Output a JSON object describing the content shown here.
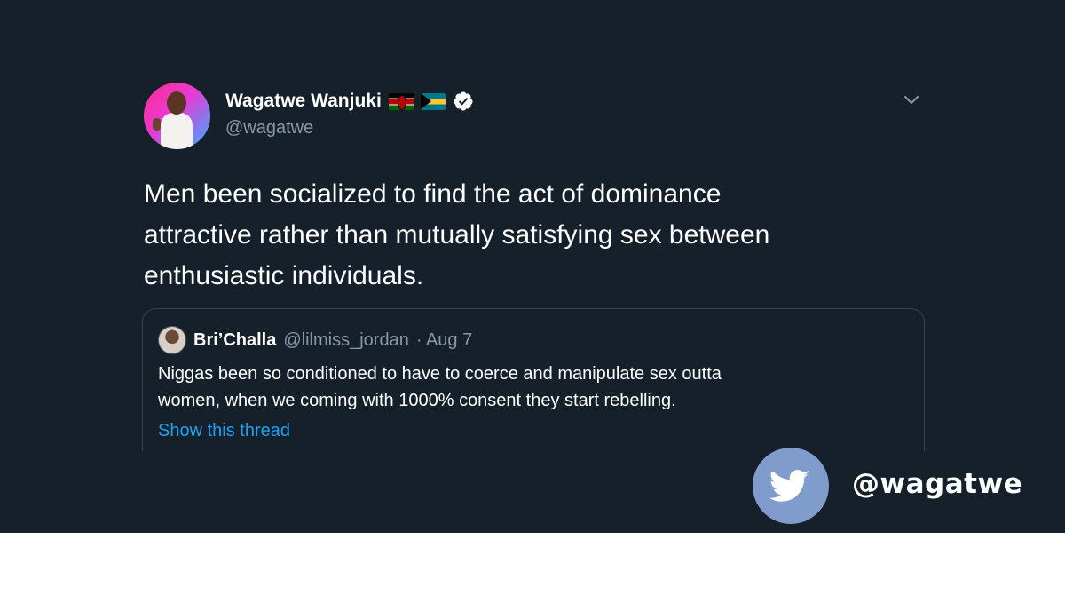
{
  "author": {
    "display_name": "Wagatwe Wanjuki",
    "handle": "@wagatwe",
    "verified": true,
    "name_flags": [
      "kenya-flag-icon",
      "bahamas-flag-icon"
    ]
  },
  "tweet": {
    "lines": [
      "Men been socialized to find the act of dominance",
      "attractive rather than mutually satisfying sex between",
      "enthusiastic individuals."
    ]
  },
  "quoted_tweet": {
    "display_name": "Bri’Challa",
    "handle": "@lilmiss_jordan",
    "date": "· Aug 7",
    "lines": [
      "Niggas been so conditioned to have to coerce and manipulate sex outta",
      "women, when we coming with 1000% consent they start rebelling."
    ],
    "show_thread_label": "Show this thread"
  },
  "watermark": {
    "handle": "@wagatwe",
    "icon": "twitter-bird-icon"
  },
  "colors": {
    "background": "#15202b",
    "text": "#ffffff",
    "secondary_text": "#8899a6",
    "link": "#1da1f2",
    "badge": "#7f9ccd"
  }
}
